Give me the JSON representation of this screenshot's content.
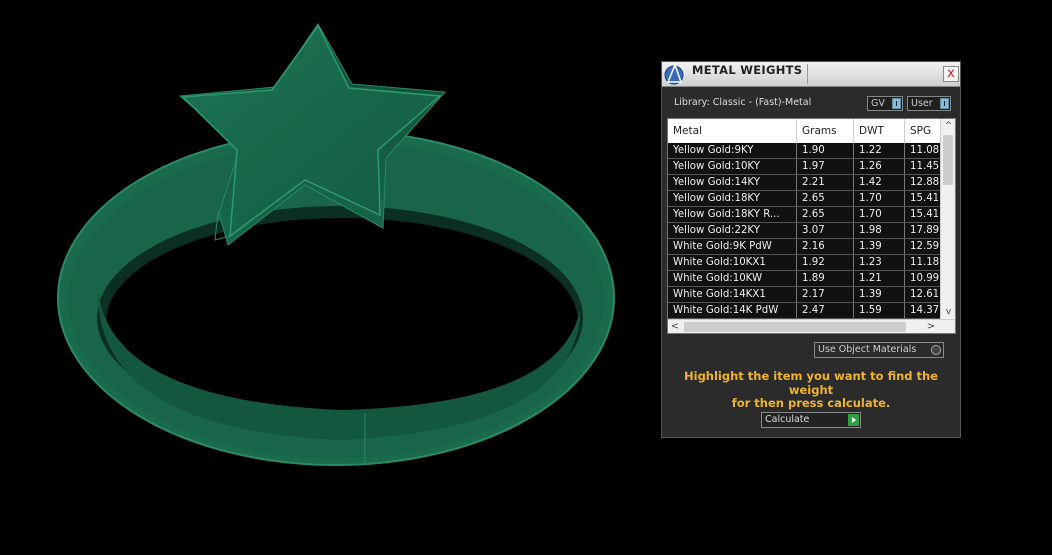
{
  "window": {
    "title": "METAL WEIGHTS",
    "close_label": "x"
  },
  "library": {
    "label": "Library: Classic - (Fast)-Metal",
    "gv_label": "GV",
    "user_label": "User"
  },
  "table": {
    "columns": [
      "Metal",
      "Grams",
      "DWT",
      "SPG"
    ],
    "rows": [
      [
        "Yellow Gold:9KY",
        "1.90",
        "1.22",
        "11.08"
      ],
      [
        "Yellow Gold:10KY",
        "1.97",
        "1.26",
        "11.45"
      ],
      [
        "Yellow Gold:14KY",
        "2.21",
        "1.42",
        "12.88"
      ],
      [
        "Yellow Gold:18KY",
        "2.65",
        "1.70",
        "15.41"
      ],
      [
        "Yellow Gold:18KY R...",
        "2.65",
        "1.70",
        "15.41"
      ],
      [
        "Yellow Gold:22KY",
        "3.07",
        "1.98",
        "17.89"
      ],
      [
        "White Gold:9K PdW",
        "2.16",
        "1.39",
        "12.59"
      ],
      [
        "White Gold:10KX1",
        "1.92",
        "1.23",
        "11.18"
      ],
      [
        "White Gold:10KW",
        "1.89",
        "1.21",
        "10.99"
      ],
      [
        "White Gold:14KX1",
        "2.17",
        "1.39",
        "12.61"
      ],
      [
        "White Gold:14K PdW",
        "2.47",
        "1.59",
        "14.37"
      ]
    ],
    "scroll_left": "<",
    "scroll_right": ">",
    "scroll_up": "^",
    "scroll_down": "v"
  },
  "options": {
    "material_dropdown": "Use Object Materials"
  },
  "hint": {
    "line1": "Highlight the item you want to find the weight",
    "line2": "for then press calculate."
  },
  "actions": {
    "calculate_label": "Calculate"
  },
  "colors": {
    "ring_green": "#1e7a57",
    "hint_yellow": "#f0b429",
    "panel_bg": "#2b2b2b",
    "go_green": "#2da043"
  },
  "icons": {
    "logo": "app-logo-icon",
    "close": "close-icon",
    "calculate": "play-arrow-icon"
  }
}
